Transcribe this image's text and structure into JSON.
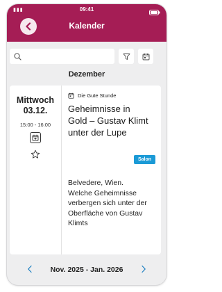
{
  "status": {
    "time": "09:41"
  },
  "header": {
    "title": "Kalender",
    "back_icon": "chevron-left-icon",
    "accent": "#a51d55"
  },
  "toolbar": {
    "search_value": "",
    "search_icon": "search-icon",
    "filter_icon": "filter-icon",
    "calendar_icon": "calendar-icon"
  },
  "month": "Dezember",
  "event": {
    "weekday": "Mittwoch",
    "date": "03.12.",
    "time": "15:00 - 16:00",
    "source": "Die Gute Stunde",
    "title": "Geheimnisse in Gold – Gustav Klimt unter der Lupe",
    "tag": "Salon",
    "tag_color": "#1b9ad6",
    "description": "Belvedere, Wien. Welche Geheimnisse verbergen sich unter der Oberfläche von Gustav Klimts"
  },
  "pager": {
    "label": "Nov. 2025 - Jan. 2026"
  }
}
